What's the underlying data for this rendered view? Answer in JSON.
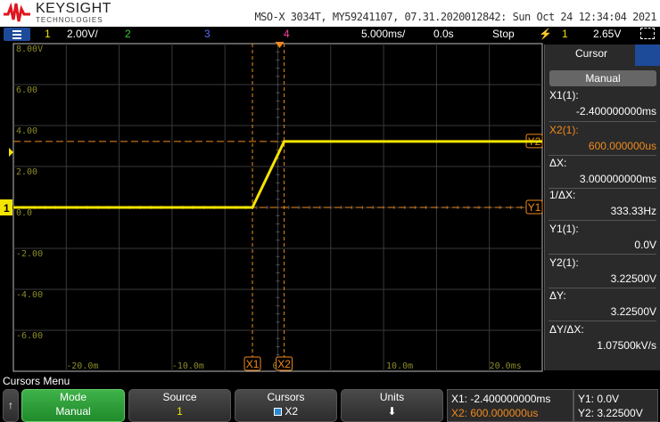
{
  "header": {
    "brand": "KEYSIGHT",
    "brand_sub": "TECHNOLOGIES",
    "instrument": "MSO-X 3034T, MY59241107, 07.31.2020012842: Sun Oct 24 12:34:04 2021"
  },
  "status_bar": {
    "ch1": "1",
    "ch1_scale": "2.00V/",
    "ch2": "2",
    "ch3": "3",
    "ch4": "4",
    "timebase": "5.000ms/",
    "delay": "0.0s",
    "run_state": "Stop",
    "trig_source": "1",
    "trig_level": "2.65V"
  },
  "graticule": {
    "y_labels": [
      "8.00V",
      "6.00",
      "4.00",
      "2.00",
      "0.0",
      "-2.00",
      "-4.00",
      "-6.00"
    ],
    "x_labels": [
      "-20.0m",
      "-10.0m",
      "0",
      "10.0m",
      "20.0ms"
    ],
    "markers": {
      "x1": "X1",
      "x2": "X2",
      "y1": "Y1",
      "y2": "Y2",
      "ch1": "1"
    }
  },
  "waveform": {
    "volts_per_div": 2,
    "ms_per_div": 5,
    "low_v": 0.0,
    "high_v": 3.225,
    "rise_start_ms": -2.4,
    "rise_end_ms": 0.6
  },
  "cursors": {
    "x1_ms": -2.4,
    "x2_ms": 0.6,
    "y1_v": 0.0,
    "y2_v": 3.225
  },
  "panel": {
    "title": "Cursor",
    "mode": "Manual",
    "x1_label": "X1(1):",
    "x1": "-2.400000000ms",
    "x2_label": "X2(1):",
    "x2": "600.000000us",
    "dx_label": "ΔX:",
    "dx": "3.000000000ms",
    "inv_dx_label": "1/ΔX:",
    "inv_dx": "333.33Hz",
    "y1_label": "Y1(1):",
    "y1": "0.0V",
    "y2_label": "Y2(1):",
    "y2": "3.22500V",
    "dy_label": "ΔY:",
    "dy": "3.22500V",
    "dydx_label": "ΔY/ΔX:",
    "dydx": "1.07500kV/s"
  },
  "menu": {
    "title": "Cursors Menu",
    "mode_label": "Mode",
    "mode_value": "Manual",
    "source_label": "Source",
    "source_value": "1",
    "cursors_label": "Cursors",
    "cursors_value": "X2",
    "units_label": "Units",
    "x1": "X1: -2.400000000ms",
    "x2": "X2: 600.000000us",
    "y1": "Y1: 0.0V",
    "y2": "Y2: 3.22500V"
  },
  "colors": {
    "ch1": "#f5e400",
    "ch2": "#3ec83e",
    "ch3": "#5a6cff",
    "ch4": "#ff3fa0",
    "cursor": "#f08a1c",
    "label": "#8a8a28"
  }
}
